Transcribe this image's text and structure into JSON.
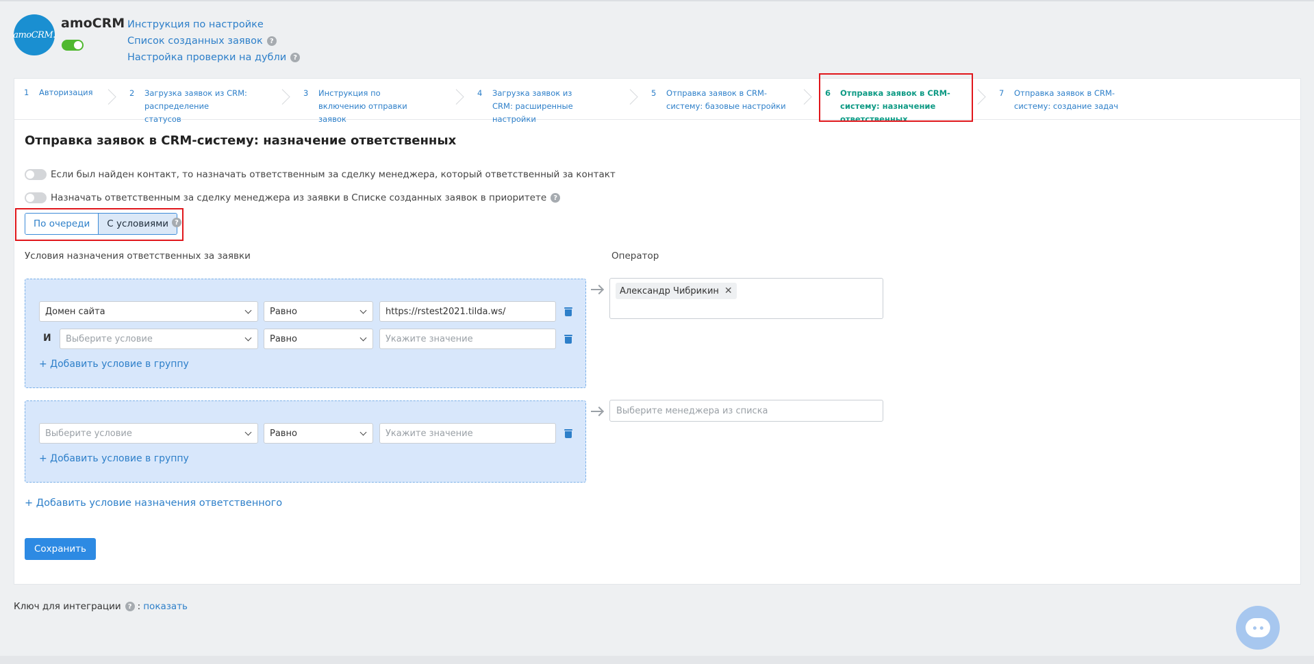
{
  "header": {
    "logo_text": "amoCRM.",
    "app_name": "amoCRM",
    "integration_enabled": true,
    "links": [
      {
        "label": "Инструкция по настройке",
        "help": false
      },
      {
        "label": "Список созданных заявок",
        "help": true
      },
      {
        "label": "Настройка проверки на дубли",
        "help": true
      }
    ]
  },
  "steps": [
    {
      "num": "1",
      "label": "Авторизация",
      "active": false
    },
    {
      "num": "2",
      "label": "Загрузка заявок из CRM: распределение статусов",
      "active": false
    },
    {
      "num": "3",
      "label": "Инструкция по включению отправки заявок",
      "active": false
    },
    {
      "num": "4",
      "label": "Загрузка заявок из CRM: расширенные настройки",
      "active": false
    },
    {
      "num": "5",
      "label": "Отправка заявок в CRM-систему: базовые настройки",
      "active": false
    },
    {
      "num": "6",
      "label": "Отправка заявок в CRM-систему: назначение ответственных",
      "active": true
    },
    {
      "num": "7",
      "label": "Отправка заявок в CRM-систему: создание задач",
      "active": false
    }
  ],
  "main": {
    "title": "Отправка заявок в CRM-систему: назначение ответственных",
    "toggle_contact_label": "Если был найден контакт, то назначать ответственным за сделку менеджера, который ответственный за контакт",
    "toggle_contact_on": false,
    "toggle_priority_label": "Назначать ответственным за сделку менеджера из заявки в Списке созданных заявок в приоритете",
    "toggle_priority_on": false,
    "mode_options": [
      "По очереди",
      "С условиями"
    ],
    "mode_selected": "С условиями",
    "conditions_header": "Условия назначения ответственных за заявки",
    "operator_header": "Оператор",
    "and_label": "И",
    "add_condition_to_group": "+ Добавить условие в группу",
    "add_assignment_condition": "+ Добавить условие назначения ответственного",
    "save_label": "Сохранить"
  },
  "groups": [
    {
      "rows": [
        {
          "field": "Домен сайта",
          "field_placeholder": false,
          "operator": "Равно",
          "value": "https://rstest2021.tilda.ws/",
          "value_placeholder": false
        },
        {
          "field": "Выберите условие",
          "field_placeholder": true,
          "operator": "Равно",
          "value": "Укажите значение",
          "value_placeholder": true
        }
      ],
      "operator_tag": "Александр Чибрикин",
      "remove_tag_icon": "close-icon"
    },
    {
      "rows": [
        {
          "field": "Выберите условие",
          "field_placeholder": true,
          "operator": "Равно",
          "value": "Укажите значение",
          "value_placeholder": true
        }
      ],
      "operator_placeholder": "Выберите менеджера из списка"
    }
  ],
  "footer": {
    "key_label": "Ключ для интеграции",
    "key_link": "показать"
  },
  "colors": {
    "link": "#2d7fc9",
    "active_step": "#0e9a84",
    "highlight_box": "#e0161b",
    "primary_button": "#2d8ae3",
    "group_bg": "#d8e7fb",
    "toggle_on": "#4fb82f"
  },
  "icons": {
    "help": "question-circle-icon",
    "delete": "trash-icon",
    "arrow": "arrow-right-icon",
    "dropdown": "chevron-down-icon",
    "chat": "chat-bubble-icon"
  }
}
